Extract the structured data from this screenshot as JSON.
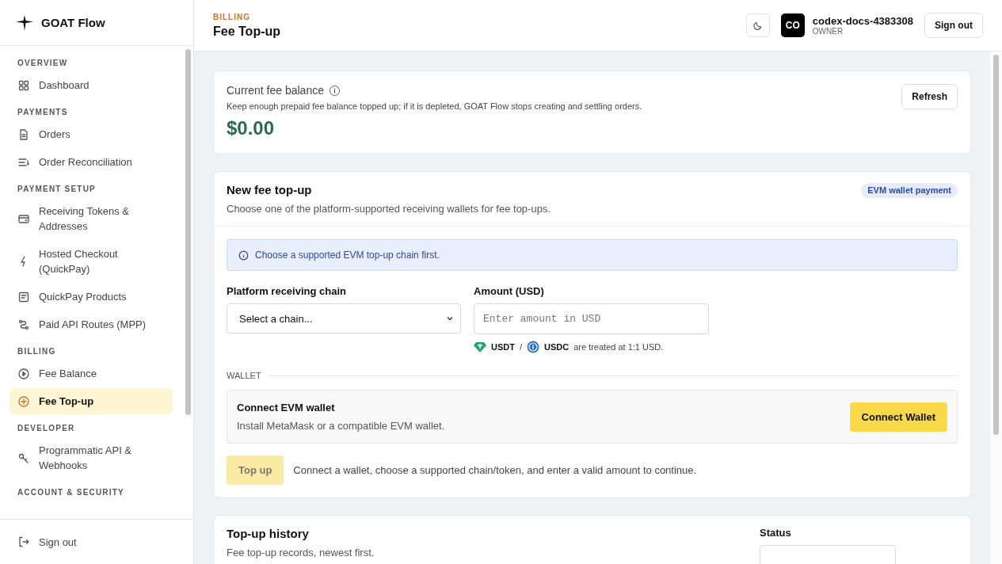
{
  "brand": {
    "name": "GOAT Flow"
  },
  "sidebar": {
    "sections": [
      {
        "title": "OVERVIEW",
        "items": [
          {
            "label": "Dashboard",
            "selected": false
          }
        ]
      },
      {
        "title": "PAYMENTS",
        "items": [
          {
            "label": "Orders",
            "selected": false
          },
          {
            "label": "Order Reconciliation",
            "selected": false
          }
        ]
      },
      {
        "title": "PAYMENT SETUP",
        "items": [
          {
            "label": "Receiving Tokens & Addresses",
            "selected": false
          },
          {
            "label": "Hosted Checkout (QuickPay)",
            "selected": false
          },
          {
            "label": "QuickPay Products",
            "selected": false
          },
          {
            "label": "Paid API Routes (MPP)",
            "selected": false
          }
        ]
      },
      {
        "title": "BILLING",
        "items": [
          {
            "label": "Fee Balance",
            "selected": false
          },
          {
            "label": "Fee Top-up",
            "selected": true
          }
        ]
      },
      {
        "title": "DEVELOPER",
        "items": [
          {
            "label": "Programmatic API & Webhooks",
            "selected": false
          }
        ]
      },
      {
        "title": "ACCOUNT & SECURITY"
      }
    ],
    "sign_out": "Sign out"
  },
  "header": {
    "eyebrow": "BILLING",
    "title": "Fee Top-up",
    "avatar": "CO",
    "user": "codex-docs-4383308",
    "role": "OWNER",
    "sign_out": "Sign out"
  },
  "balance": {
    "label": "Current fee balance",
    "note": "Keep enough prepaid fee balance topped up; if it is depleted, GOAT Flow stops creating and settling orders.",
    "amount": "$0.00",
    "refresh": "Refresh"
  },
  "topup": {
    "title": "New fee top-up",
    "badge": "EVM wallet payment",
    "subtitle": "Choose one of the platform-supported receiving wallets for fee top-ups.",
    "alert": "Choose a supported EVM top-up chain first.",
    "chain_label": "Platform receiving chain",
    "chain_value": "Select a chain...",
    "amount_label": "Amount (USD)",
    "amount_placeholder": "Enter amount in USD",
    "tokens": [
      "USDT",
      "USDC"
    ],
    "token_sep": "/",
    "token_note": "are treated at 1:1 USD.",
    "wallet_heading": "WALLET",
    "wallet_title": "Connect EVM wallet",
    "wallet_note": "Install MetaMask or a compatible EVM wallet.",
    "connect": "Connect Wallet",
    "submit": {
      "label": "Top up",
      "disabled": true
    },
    "submit_note": "Connect a wallet, choose a supported chain/token, and enter a valid amount to continue."
  },
  "history": {
    "title": "Top-up history",
    "subtitle": "Fee top-up records, newest first.",
    "status_label": "Status"
  }
}
